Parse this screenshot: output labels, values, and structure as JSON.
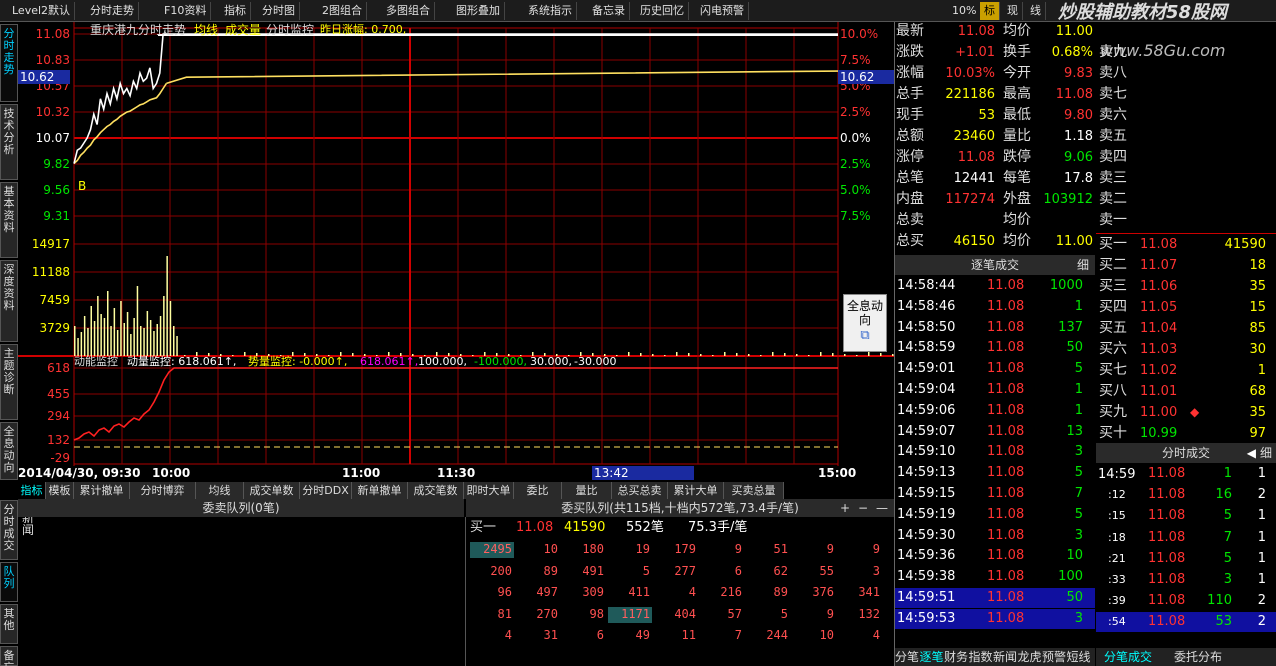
{
  "toolbar": {
    "items": [
      "Level2默认",
      "分时走势",
      "F10资料",
      "指标",
      "分时图",
      "2图组合",
      "多图组合",
      "图形叠加",
      "系统指示",
      "备忘录",
      "历史回忆",
      "闪电预警"
    ],
    "zoom": "10%",
    "right_tabs": [
      "标",
      "现",
      "线"
    ],
    "watermark": "炒股辅助教材58股网",
    "watermark_url": "www.58Gu.com"
  },
  "left_tabs": [
    "分时走势",
    "技术分析",
    "基本资料",
    "深度资料",
    "主题诊断",
    "全息动向"
  ],
  "bottom_left_tabs": [
    "分时成交",
    "队列",
    "其他",
    "备忘"
  ],
  "chart": {
    "title": "重庆港九分时走势",
    "legend1": "均线",
    "legend2": "成交量",
    "legend3": "分时监控",
    "legend4": "昨日涨幅: 0.700,",
    "price_labels": [
      "11.08",
      "10.83",
      "10.57",
      "10.32",
      "10.07",
      "9.82",
      "9.56",
      "9.31"
    ],
    "pct_labels": [
      "10.0%",
      "7.5%",
      "5.0%",
      "2.5%",
      "0.0%",
      "2.5%",
      "5.0%",
      "7.5%"
    ],
    "cur_price": "10.62",
    "vol_labels": [
      "14917",
      "11188",
      "7459",
      "3729"
    ],
    "buy_marker": "B",
    "sub_title": "动能监控",
    "sub_l1": "动量监控: 618.061↑,",
    "sub_l2": "势量监控: -0.000↑,",
    "sub_l3": "618.061↑,",
    "sub_l4": "100.000,",
    "sub_l5": "-100.000,",
    "sub_l6": "30.000,",
    "sub_l7": "-30.000",
    "sub_labels": [
      "618",
      "455",
      "294",
      "132",
      "-29"
    ],
    "time_labels": [
      "2014/04/30, 09:30",
      "10:00",
      "11:00",
      "11:30",
      "13:42",
      "15:00"
    ],
    "popup": "全息动向"
  },
  "chart_data": {
    "type": "line",
    "x": [
      "09:30",
      "09:31",
      "09:32",
      "09:33",
      "09:34",
      "09:35",
      "09:36",
      "09:37",
      "09:38",
      "09:39",
      "09:40",
      "09:41",
      "09:42",
      "09:43",
      "09:44",
      "09:45",
      "09:46",
      "09:47",
      "09:48",
      "09:49",
      "09:50",
      "09:51",
      "09:52",
      "09:53",
      "09:54",
      "09:55",
      "09:56",
      "09:57",
      "09:58"
    ],
    "series": [
      {
        "values": [
          9.82,
          9.95,
          9.97,
          10.02,
          10.07,
          10.15,
          10.3,
          10.2,
          10.45,
          10.35,
          10.5,
          10.4,
          10.55,
          10.45,
          10.6,
          10.5,
          10.55,
          10.48,
          10.62,
          10.55,
          10.7,
          10.62,
          10.65,
          10.75,
          10.55,
          10.6,
          10.7,
          11.08,
          11.08
        ]
      },
      {
        "values": [
          9.82,
          9.85,
          9.9,
          9.93,
          9.97,
          10.0,
          10.05,
          10.08,
          10.12,
          10.15,
          10.18,
          10.2,
          10.23,
          10.25,
          10.28,
          10.3,
          10.32,
          10.33,
          10.35,
          10.37,
          10.39,
          10.4,
          10.42,
          10.44,
          10.45,
          10.46,
          10.5,
          10.55,
          10.6
        ]
      }
    ],
    "ylim": [
      9.31,
      11.08
    ]
  },
  "quote": {
    "rows": [
      [
        "最新",
        "11.08",
        "均价",
        "11.00"
      ],
      [
        "涨跌",
        "+1.01",
        "换手",
        "0.68%"
      ],
      [
        "涨幅",
        "10.03%",
        "今开",
        "9.83"
      ],
      [
        "总手",
        "221186",
        "最高",
        "11.08"
      ],
      [
        "现手",
        "53",
        "最低",
        "9.80"
      ],
      [
        "总额",
        "23460",
        "量比",
        "1.18"
      ],
      [
        "涨停",
        "11.08",
        "跌停",
        "9.06"
      ],
      [
        "总笔",
        "12441",
        "每笔",
        "17.8"
      ],
      [
        "内盘",
        "117274",
        "外盘",
        "103912"
      ],
      [
        "总卖",
        "",
        "均价",
        ""
      ],
      [
        "总买",
        "46150",
        "均价",
        "11.00"
      ]
    ],
    "sell_levels": [
      "卖九",
      "卖八",
      "卖七",
      "卖六",
      "卖五",
      "卖四",
      "卖三",
      "卖二",
      "卖一"
    ],
    "buy_levels": [
      [
        "买一",
        "11.08",
        "41590"
      ],
      [
        "买二",
        "11.07",
        "18"
      ],
      [
        "买三",
        "11.06",
        "35"
      ],
      [
        "买四",
        "11.05",
        "15"
      ],
      [
        "买五",
        "11.04",
        "85"
      ],
      [
        "买六",
        "11.03",
        "30"
      ],
      [
        "买七",
        "11.02",
        "1"
      ],
      [
        "买八",
        "11.01",
        "68"
      ],
      [
        "买九",
        "11.00",
        "35"
      ],
      [
        "买十",
        "10.99",
        "97"
      ]
    ]
  },
  "tick": {
    "title": "逐笔成交",
    "detail": "细",
    "rows": [
      [
        "14:58:44",
        "11.08",
        "1000"
      ],
      [
        "14:58:46",
        "11.08",
        "1"
      ],
      [
        "14:58:50",
        "11.08",
        "137"
      ],
      [
        "14:58:59",
        "11.08",
        "50"
      ],
      [
        "14:59:01",
        "11.08",
        "5"
      ],
      [
        "14:59:04",
        "11.08",
        "1"
      ],
      [
        "14:59:06",
        "11.08",
        "1"
      ],
      [
        "14:59:07",
        "11.08",
        "13"
      ],
      [
        "14:59:10",
        "11.08",
        "3"
      ],
      [
        "14:59:13",
        "11.08",
        "5"
      ],
      [
        "14:59:15",
        "11.08",
        "7"
      ],
      [
        "14:59:19",
        "11.08",
        "5"
      ],
      [
        "14:59:30",
        "11.08",
        "3"
      ],
      [
        "14:59:36",
        "11.08",
        "10"
      ],
      [
        "14:59:38",
        "11.08",
        "100"
      ],
      [
        "14:59:51",
        "11.08",
        "50"
      ],
      [
        "14:59:53",
        "11.08",
        "3"
      ]
    ],
    "tabs": [
      "分笔",
      "逐笔",
      "财务",
      "指数",
      "新闻",
      "龙虎",
      "预警",
      "短线"
    ]
  },
  "minute": {
    "title": "分时成交",
    "detail": "细",
    "rows": [
      [
        "14:59",
        "11.08",
        "1",
        "1"
      ],
      [
        ":12",
        "11.08",
        "16",
        "2"
      ],
      [
        ":15",
        "11.08",
        "5",
        "1"
      ],
      [
        ":18",
        "11.08",
        "7",
        "1"
      ],
      [
        ":21",
        "11.08",
        "5",
        "1"
      ],
      [
        ":33",
        "11.08",
        "3",
        "1"
      ],
      [
        ":39",
        "11.08",
        "110",
        "2"
      ],
      [
        ":54",
        "11.08",
        "53",
        "2"
      ]
    ],
    "tabs": [
      "分笔成交",
      "委托分布"
    ]
  },
  "bottom_tabs": [
    "指标",
    "模板",
    "累计撤单",
    "分时博弈",
    "均线",
    "成交单数",
    "分时DDX",
    "新单撤单",
    "成交笔数",
    "即时大单",
    "委比",
    "量比",
    "总买总卖",
    "累计大单",
    "买卖总量"
  ],
  "queue": {
    "sell_title": "委卖队列(0笔)",
    "buy_title": "委买队列(共115档,十档内572笔,73.4手/笔)",
    "buy1": "买一",
    "buy1_price": "11.08",
    "buy1_vol": "41590",
    "buy1_count": "552笔",
    "buy1_avg": "75.3手/笔",
    "cells": [
      [
        "2495",
        "10",
        "180",
        "19",
        "179",
        "9",
        "51",
        "9",
        "9"
      ],
      [
        "200",
        "89",
        "491",
        "5",
        "277",
        "6",
        "62",
        "55",
        "3"
      ],
      [
        "96",
        "497",
        "309",
        "411",
        "4",
        "216",
        "89",
        "376",
        "341"
      ],
      [
        "81",
        "270",
        "98",
        "1171",
        "404",
        "57",
        "5",
        "9",
        "132"
      ],
      [
        "4",
        "31",
        "6",
        "49",
        "11",
        "7",
        "244",
        "10",
        "4"
      ]
    ]
  }
}
